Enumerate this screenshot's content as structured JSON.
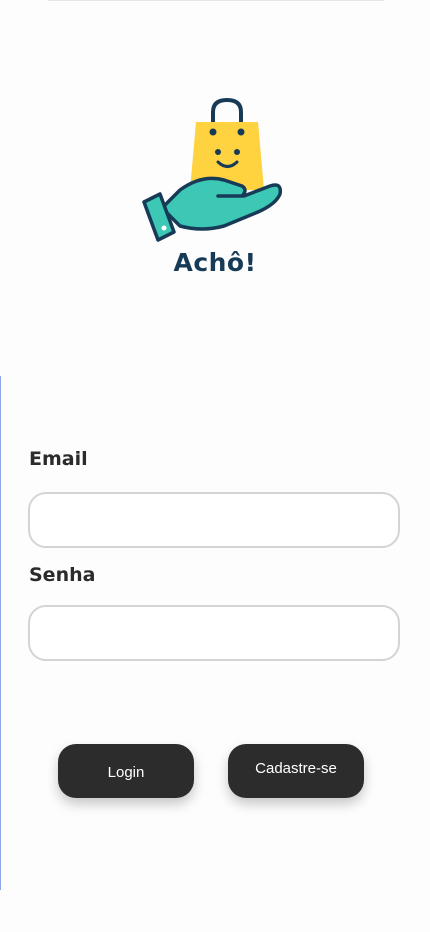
{
  "brand": {
    "name": "Achô!",
    "colors": {
      "bag": "#ffd23f",
      "hand": "#3cc8b4",
      "outline": "#173b57"
    }
  },
  "form": {
    "email_label": "Email",
    "email_value": "",
    "email_placeholder": "",
    "password_label": "Senha",
    "password_value": "",
    "password_placeholder": ""
  },
  "actions": {
    "login_label": "Login",
    "signup_label": "Cadastre-se"
  },
  "theme": {
    "button_bg": "#2c2c2c",
    "input_border": "#d4d4d4"
  }
}
